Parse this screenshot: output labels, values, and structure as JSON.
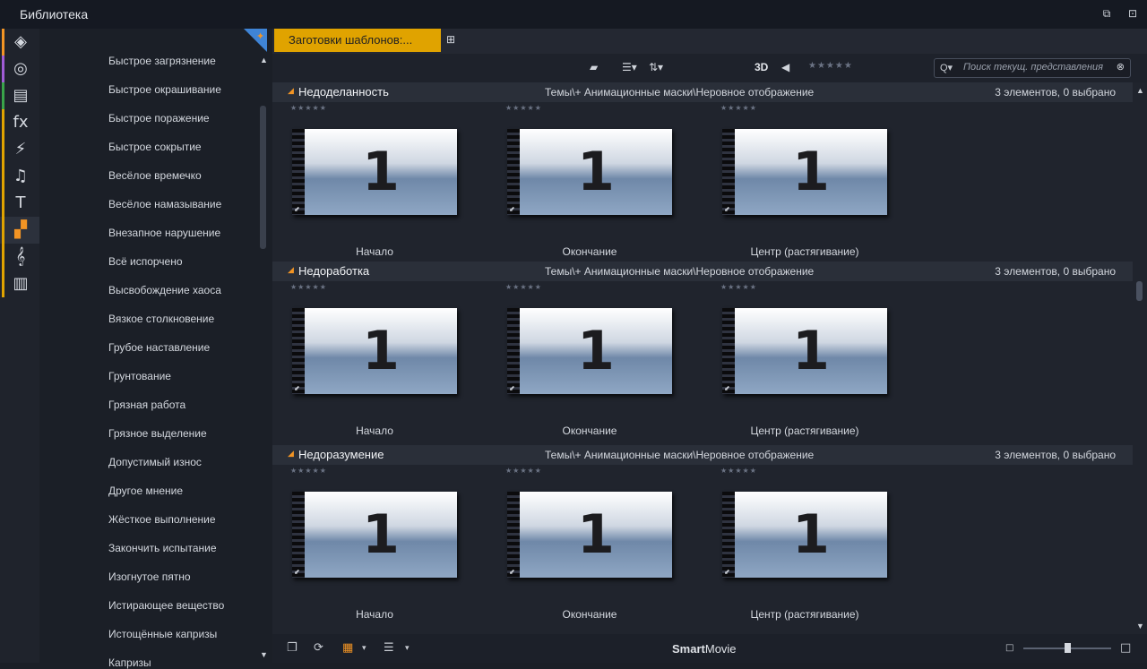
{
  "window": {
    "title": "Библиотека"
  },
  "categories": [
    {
      "icon": "project-box-icon",
      "glyph": "◈",
      "bar": "#f29424"
    },
    {
      "icon": "film-reel-icon",
      "glyph": "◎",
      "bar": "#a05cd6"
    },
    {
      "icon": "photos-icon",
      "glyph": "▤",
      "bar": "#39a34a"
    },
    {
      "icon": "fx-icon",
      "glyph": "fx",
      "bar": "#e0a300"
    },
    {
      "icon": "transition-bolt-icon",
      "glyph": "⚡",
      "bar": "#e0a300"
    },
    {
      "icon": "music-note-icon",
      "glyph": "♫",
      "bar": "#e0a300"
    },
    {
      "icon": "title-text-icon",
      "glyph": "T",
      "bar": "#e0a300"
    },
    {
      "icon": "montage-templates-icon",
      "glyph": "▞",
      "bar": "#e0a300"
    },
    {
      "icon": "sound-effects-icon",
      "glyph": "𝄞",
      "bar": "#e0a300"
    },
    {
      "icon": "piano-icon",
      "glyph": "▥",
      "bar": "#e0a300"
    }
  ],
  "tree_items": [
    "Быстрое загрязнение",
    "Быстрое окрашивание",
    "Быстрое поражение",
    "Быстрое сокрытие",
    "Весёлое времечко",
    "Весёлое намазывание",
    "Внезапное нарушение",
    "Всё испорчено",
    "Высвобождение хаоса",
    "Вязкое столкновение",
    "Грубое наставление",
    "Грунтование",
    "Грязная работа",
    "Грязное выделение",
    "Допустимый износ",
    "Другое мнение",
    "Жёсткое выполнение",
    "Закончить испытание",
    "Изогнутое пятно",
    "Истирающее вещество",
    "Истощённые капризы",
    "Капризы"
  ],
  "tab": {
    "label": "Заготовки шаблонов:..."
  },
  "toolbar": {
    "label_3d": "3D",
    "stars": "★★★★★"
  },
  "search": {
    "placeholder": "Поиск текущ. представления"
  },
  "groups": [
    {
      "name": "Недоделанность",
      "path": "Темы\\+ Анимационные маски\\Неровное отображение",
      "count": "3 элементов, 0 выбрано",
      "tiles": [
        {
          "label": "Начало",
          "stars": "★★★★★",
          "num": "1"
        },
        {
          "label": "Окончание",
          "stars": "★★★★★",
          "num": "1"
        },
        {
          "label": "Центр (растягивание)",
          "stars": "★★★★★",
          "num": "1"
        }
      ]
    },
    {
      "name": "Недоработка",
      "path": "Темы\\+ Анимационные маски\\Неровное отображение",
      "count": "3 элементов, 0 выбрано",
      "tiles": [
        {
          "label": "Начало",
          "stars": "★★★★★",
          "num": "1"
        },
        {
          "label": "Окончание",
          "stars": "★★★★★",
          "num": "1"
        },
        {
          "label": "Центр (растягивание)",
          "stars": "★★★★★",
          "num": "1"
        }
      ]
    },
    {
      "name": "Недоразумение",
      "path": "Темы\\+ Анимационные маски\\Неровное отображение",
      "count": "3 элементов, 0 выбрано",
      "tiles": [
        {
          "label": "Начало",
          "stars": "★★★★★",
          "num": "1"
        },
        {
          "label": "Окончание",
          "stars": "★★★★★",
          "num": "1"
        },
        {
          "label": "Центр (растягивание)",
          "stars": "★★★★★",
          "num": "1"
        }
      ]
    }
  ],
  "bottom": {
    "brand_bold": "Smart",
    "brand_rest": "Movie"
  },
  "zoom": {
    "level": 0.5
  }
}
